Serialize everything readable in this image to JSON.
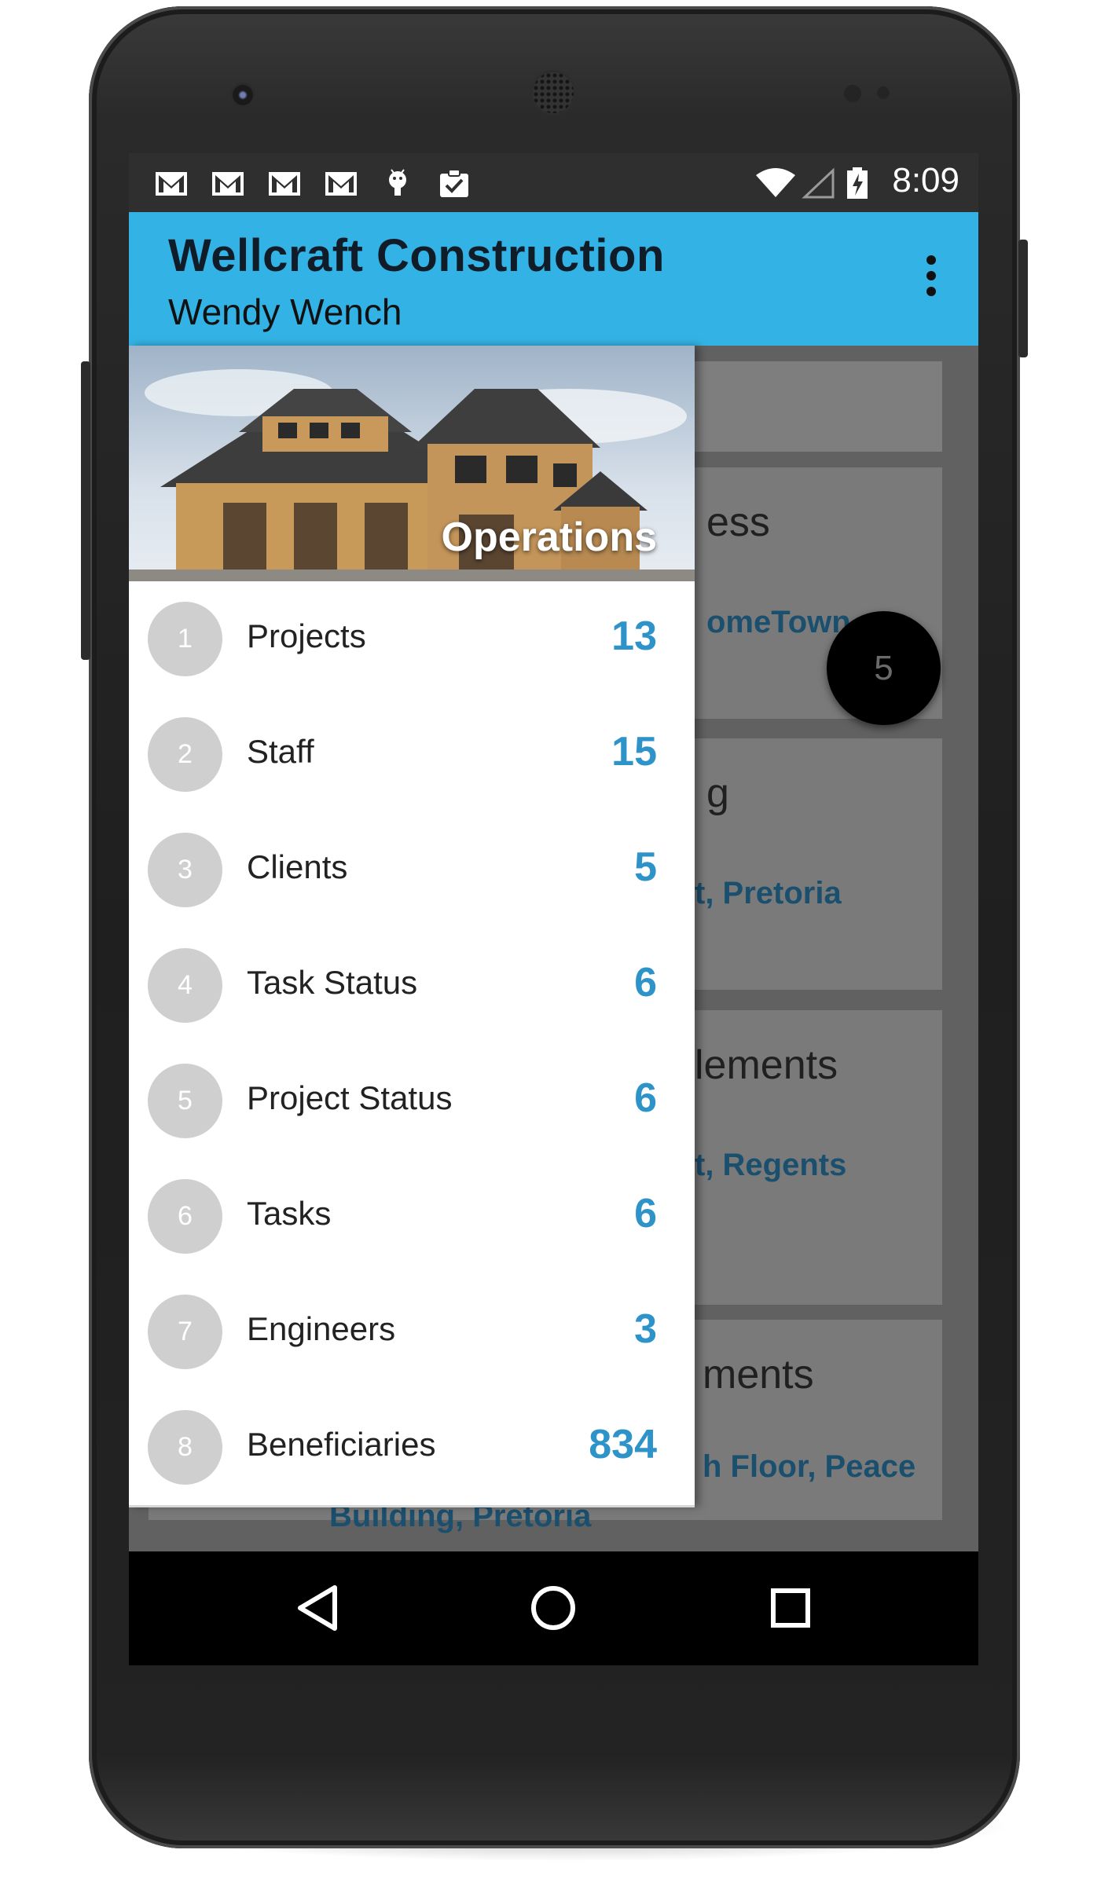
{
  "status_bar": {
    "time": "8:09",
    "notification_icons": [
      "gmail-icon",
      "gmail-icon",
      "gmail-icon",
      "gmail-icon",
      "android-icon",
      "clipboard-check-icon"
    ],
    "system_icons": [
      "wifi-icon",
      "signal-icon",
      "battery-charging-icon"
    ]
  },
  "app_bar": {
    "title": "Wellcraft Construction",
    "subtitle": "Wendy Wench",
    "menu_icon": "more-vert-icon"
  },
  "drawer": {
    "header_label": "Operations",
    "items": [
      {
        "index": "1",
        "label": "Projects",
        "count": "13"
      },
      {
        "index": "2",
        "label": "Staff",
        "count": "15"
      },
      {
        "index": "3",
        "label": "Clients",
        "count": "5"
      },
      {
        "index": "4",
        "label": "Task Status",
        "count": "6"
      },
      {
        "index": "5",
        "label": "Project Status",
        "count": "6"
      },
      {
        "index": "6",
        "label": "Tasks",
        "count": "6"
      },
      {
        "index": "7",
        "label": "Engineers",
        "count": "3"
      },
      {
        "index": "8",
        "label": "Beneficiaries",
        "count": "834"
      }
    ]
  },
  "background_content": {
    "fab_value": "5",
    "cards": [
      {
        "title_fragment": "ess",
        "address_fragment": "omeTown"
      },
      {
        "title_fragment": "g",
        "address_fragment": "t, Pretoria"
      },
      {
        "title_fragment": "lements",
        "address_fragment": "t, Regents"
      },
      {
        "title_fragment": "ments",
        "address_fragment": "h Floor, Peace",
        "address_line2": "Building, Pretoria"
      }
    ]
  },
  "nav_bar": {
    "buttons": [
      "back-icon",
      "home-icon",
      "recents-icon"
    ]
  },
  "colors": {
    "app_bar": "#33b3e5",
    "count_accent": "#2d93c9",
    "status_bar": "#2f2f2f"
  }
}
